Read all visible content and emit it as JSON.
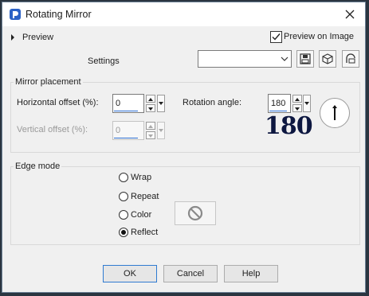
{
  "window": {
    "title": "Rotating Mirror"
  },
  "preview": {
    "label": "Preview",
    "preview_on_image": "Preview on Image",
    "preview_on_image_checked": true
  },
  "settings": {
    "label": "Settings",
    "preset_value": ""
  },
  "mirror_placement": {
    "title": "Mirror placement",
    "horizontal_offset": {
      "label": "Horizontal offset (%):",
      "value": "0"
    },
    "vertical_offset": {
      "label": "Vertical offset (%):",
      "value": "0",
      "enabled": false
    },
    "rotation_angle": {
      "label": "Rotation angle:",
      "value": "180",
      "display": "180"
    }
  },
  "edge_mode": {
    "title": "Edge mode",
    "options": [
      {
        "label": "Wrap",
        "selected": false
      },
      {
        "label": "Repeat",
        "selected": false
      },
      {
        "label": "Color",
        "selected": false
      },
      {
        "label": "Reflect",
        "selected": true
      }
    ]
  },
  "buttons": {
    "ok": "OK",
    "cancel": "Cancel",
    "help": "Help"
  },
  "colors": {
    "accent": "#2d6fd1",
    "dialog_bg": "#f0f0f0",
    "big_text": "#0d1740"
  },
  "icons": [
    "app-icon",
    "close-icon",
    "dropdown-arrow-icon",
    "save-preset-icon",
    "reset-cube-icon",
    "random-icon",
    "no-color-icon"
  ]
}
